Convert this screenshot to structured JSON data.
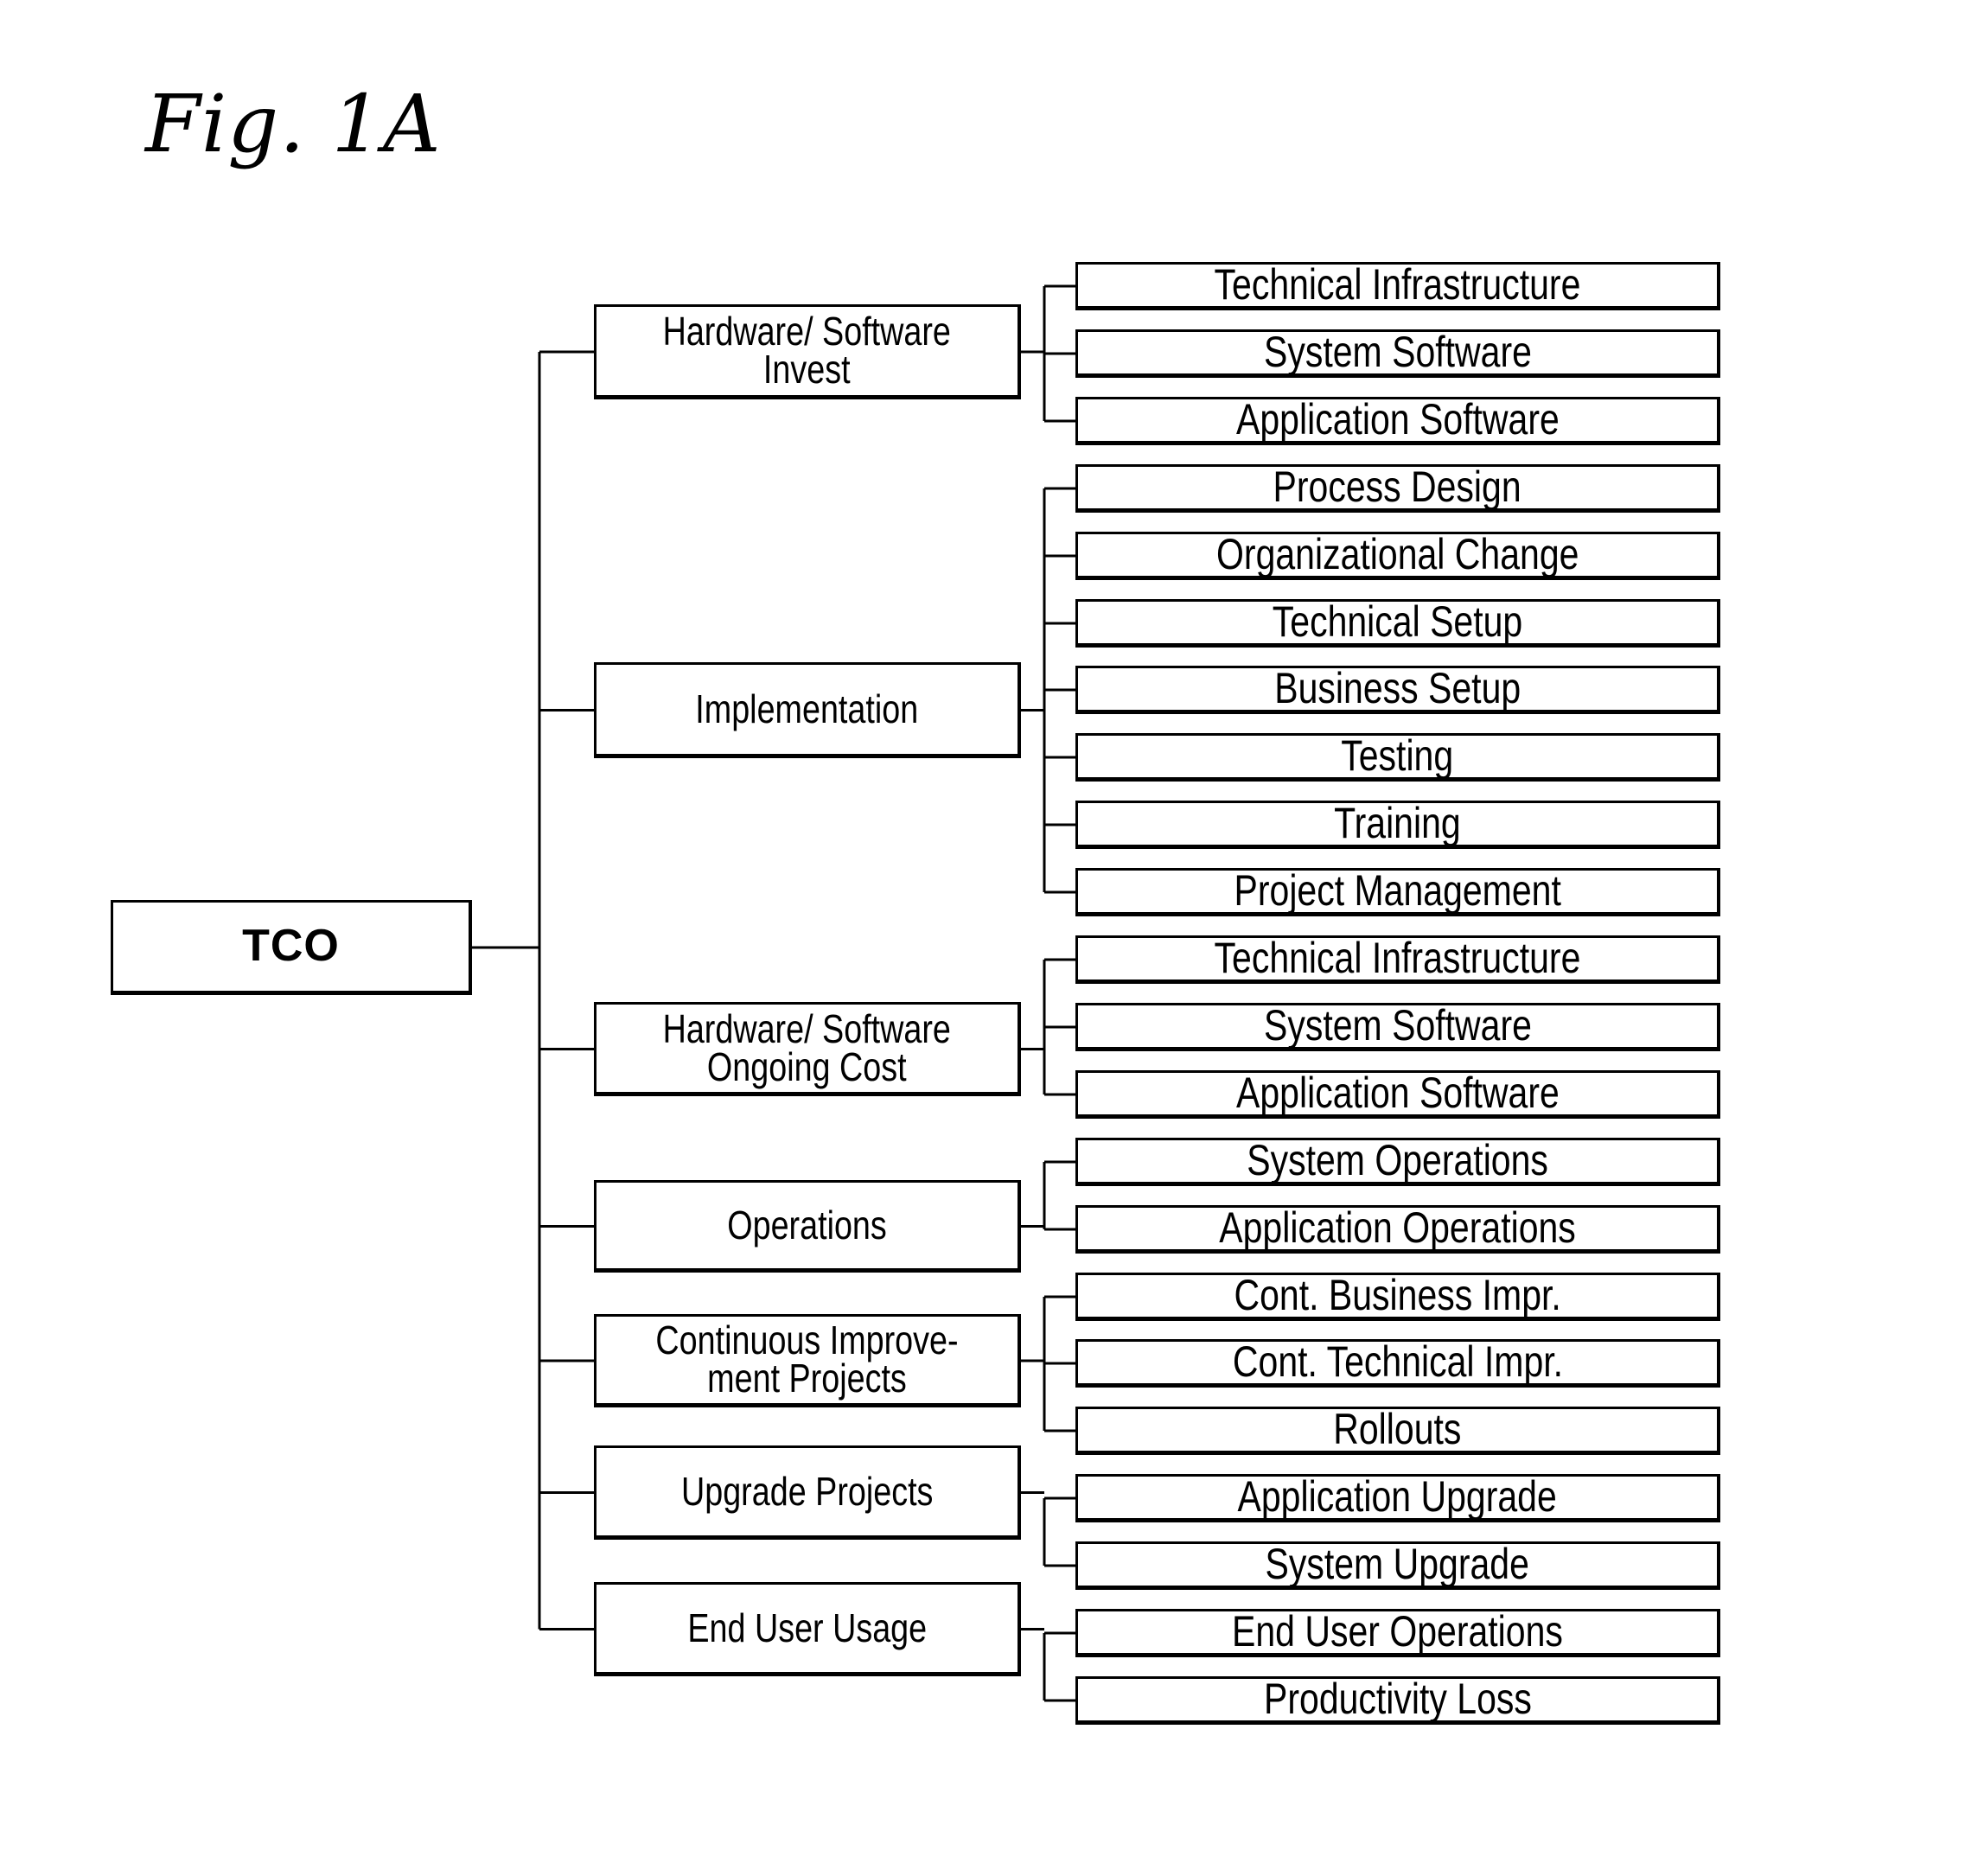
{
  "figure": {
    "title": "Fig. 1A"
  },
  "tree": {
    "root": {
      "label": "TCO"
    },
    "categories": [
      {
        "label": "Hardware/ Software Invest",
        "lines": [
          "Hardware/ Software",
          "Invest"
        ],
        "children": [
          "Technical Infrastructure",
          "System Software",
          "Application Software"
        ]
      },
      {
        "label": "Implementation",
        "lines": [
          "Implementation"
        ],
        "children": [
          "Process Design",
          "Organizational Change",
          "Technical Setup",
          "Business Setup",
          "Testing",
          "Training",
          "Project Management"
        ]
      },
      {
        "label": "Hardware/ Software Ongoing Cost",
        "lines": [
          "Hardware/ Software",
          "Ongoing Cost"
        ],
        "children": [
          "Technical Infrastructure",
          "System Software",
          "Application Software"
        ]
      },
      {
        "label": "Operations",
        "lines": [
          "Operations"
        ],
        "children": [
          "System Operations",
          "Application Operations"
        ]
      },
      {
        "label": "Continuous Improvement Projects",
        "lines": [
          "Continuous Improve-",
          "ment Projects"
        ],
        "children": [
          "Cont. Business Impr.",
          "Cont. Technical Impr.",
          "Rollouts"
        ]
      },
      {
        "label": "Upgrade Projects",
        "lines": [
          "Upgrade Projects"
        ],
        "children": [
          "Application Upgrade",
          "System Upgrade"
        ]
      },
      {
        "label": "End User Usage",
        "lines": [
          "End User Usage"
        ],
        "children": [
          "End User Operations",
          "Productivity Loss"
        ]
      }
    ]
  }
}
